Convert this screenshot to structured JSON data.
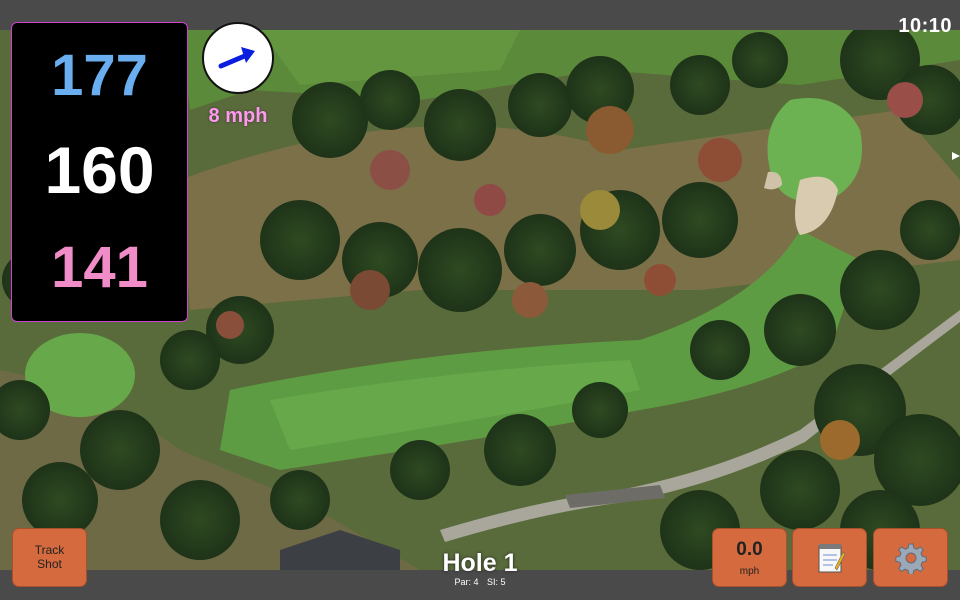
{
  "status_bar": {
    "time": "10:10"
  },
  "distances": {
    "back": "177",
    "middle": "160",
    "front": "141",
    "colors": {
      "back": "#6aaef0",
      "middle": "#ffffff",
      "front": "#f08cc8",
      "panel_border": "#cc44cc"
    }
  },
  "wind": {
    "speed_label": "8 mph",
    "arrow_icon": "wind-direction-arrow",
    "arrow_color": "#0a1ee0",
    "speed_color": "#ff99ee"
  },
  "hole": {
    "title": "Hole 1",
    "par_label": "Par: 4",
    "si_label": "SI: 5"
  },
  "buttons": {
    "track_shot_line1": "Track",
    "track_shot_line2": "Shot",
    "speed_value": "0.0",
    "speed_unit": "mph",
    "notes_icon": "notepad-icon",
    "settings_icon": "gear-icon",
    "color": "#d46a3e"
  }
}
